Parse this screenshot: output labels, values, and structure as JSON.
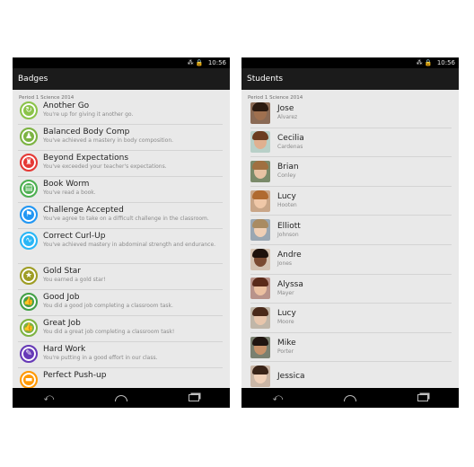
{
  "left_screen": {
    "status": {
      "signal_icons": "⁂ 🔒",
      "time": "10:56"
    },
    "title": "Badges",
    "section": "Period 1 Science 2014",
    "badges": [
      {
        "title": "Another Go",
        "desc": "You're up for giving it another go.",
        "color": "#8bc34a",
        "icon": "refresh-icon",
        "glyph": "↻"
      },
      {
        "title": "Balanced Body Comp",
        "desc": "You've achieved a mastery in body composition.",
        "color": "#7cb342",
        "icon": "body-icon",
        "glyph": "♟"
      },
      {
        "title": "Beyond Expectations",
        "desc": "You've exceeded your teacher's expectations.",
        "color": "#e53935",
        "icon": "trophy-icon",
        "glyph": "♜"
      },
      {
        "title": "Book Worm",
        "desc": "You've read a book.",
        "color": "#4caf50",
        "icon": "book-icon",
        "glyph": "▤"
      },
      {
        "title": "Challenge Accepted",
        "desc": "You've agree to take on a difficult challenge in the classroom.",
        "color": "#2196f3",
        "icon": "flag-icon",
        "glyph": "⚑"
      },
      {
        "title": "Correct Curl-Up",
        "desc": "You've achieved mastery in abdominal strength and endurance.",
        "color": "#29b6f6",
        "icon": "curl-up-icon",
        "glyph": "∿"
      },
      {
        "title": "Gold Star",
        "desc": "You earned a gold star!",
        "color": "#9e9d24",
        "icon": "star-icon",
        "glyph": "★"
      },
      {
        "title": "Good Job",
        "desc": "You did a good job completing a classroom task.",
        "color": "#43a047",
        "icon": "thumbs-up-icon",
        "glyph": "👍"
      },
      {
        "title": "Great Job",
        "desc": "You did a great job completing a classroom task!",
        "color": "#7cb342",
        "icon": "thumbs-up-icon",
        "glyph": "👍"
      },
      {
        "title": "Hard Work",
        "desc": "You're putting in a good effort in our class.",
        "color": "#673ab7",
        "icon": "effort-icon",
        "glyph": "✎"
      },
      {
        "title": "Perfect Push-up",
        "desc": "",
        "color": "#ff9800",
        "icon": "pushup-icon",
        "glyph": "▬"
      }
    ],
    "nav": {
      "back": "⤺",
      "home": "home",
      "recent": "recent"
    }
  },
  "right_screen": {
    "status": {
      "signal_icons": "⁂ 🔒",
      "time": "10:56"
    },
    "title": "Students",
    "section": "Period 1 Science 2014",
    "students": [
      {
        "first": "Jose",
        "last": "Alvarez",
        "skin": "#a0704f",
        "hair": "#2b1a10",
        "bg": "#8a6a55"
      },
      {
        "first": "Cecilia",
        "last": "Cardenas",
        "skin": "#e0b090",
        "hair": "#6b3d1f",
        "bg": "#b8d0c8"
      },
      {
        "first": "Brian",
        "last": "Conley",
        "skin": "#e7c2a3",
        "hair": "#a07040",
        "bg": "#7a8a6a"
      },
      {
        "first": "Lucy",
        "last": "Hooten",
        "skin": "#f0c8a8",
        "hair": "#b06a30",
        "bg": "#c9a688"
      },
      {
        "first": "Elliott",
        "last": "Johnson",
        "skin": "#efcfb5",
        "hair": "#a98b62",
        "bg": "#9aa7b2"
      },
      {
        "first": "Andre",
        "last": "Jones",
        "skin": "#7a4a30",
        "hair": "#1e120b",
        "bg": "#d4c2b0"
      },
      {
        "first": "Alyssa",
        "last": "Mayer",
        "skin": "#ebc0a0",
        "hair": "#5a2a1a",
        "bg": "#b8938a"
      },
      {
        "first": "Lucy",
        "last": "Moore",
        "skin": "#e8c6ac",
        "hair": "#4a2a1a",
        "bg": "#c0b6a8"
      },
      {
        "first": "Mike",
        "last": "Porter",
        "skin": "#c8926a",
        "hair": "#201510",
        "bg": "#7a8070"
      },
      {
        "first": "Jessica",
        "last": "",
        "skin": "#f0d0b8",
        "hair": "#3a2418",
        "bg": "#cab6a6"
      }
    ],
    "nav": {
      "back": "⤺",
      "home": "home",
      "recent": "recent"
    }
  }
}
